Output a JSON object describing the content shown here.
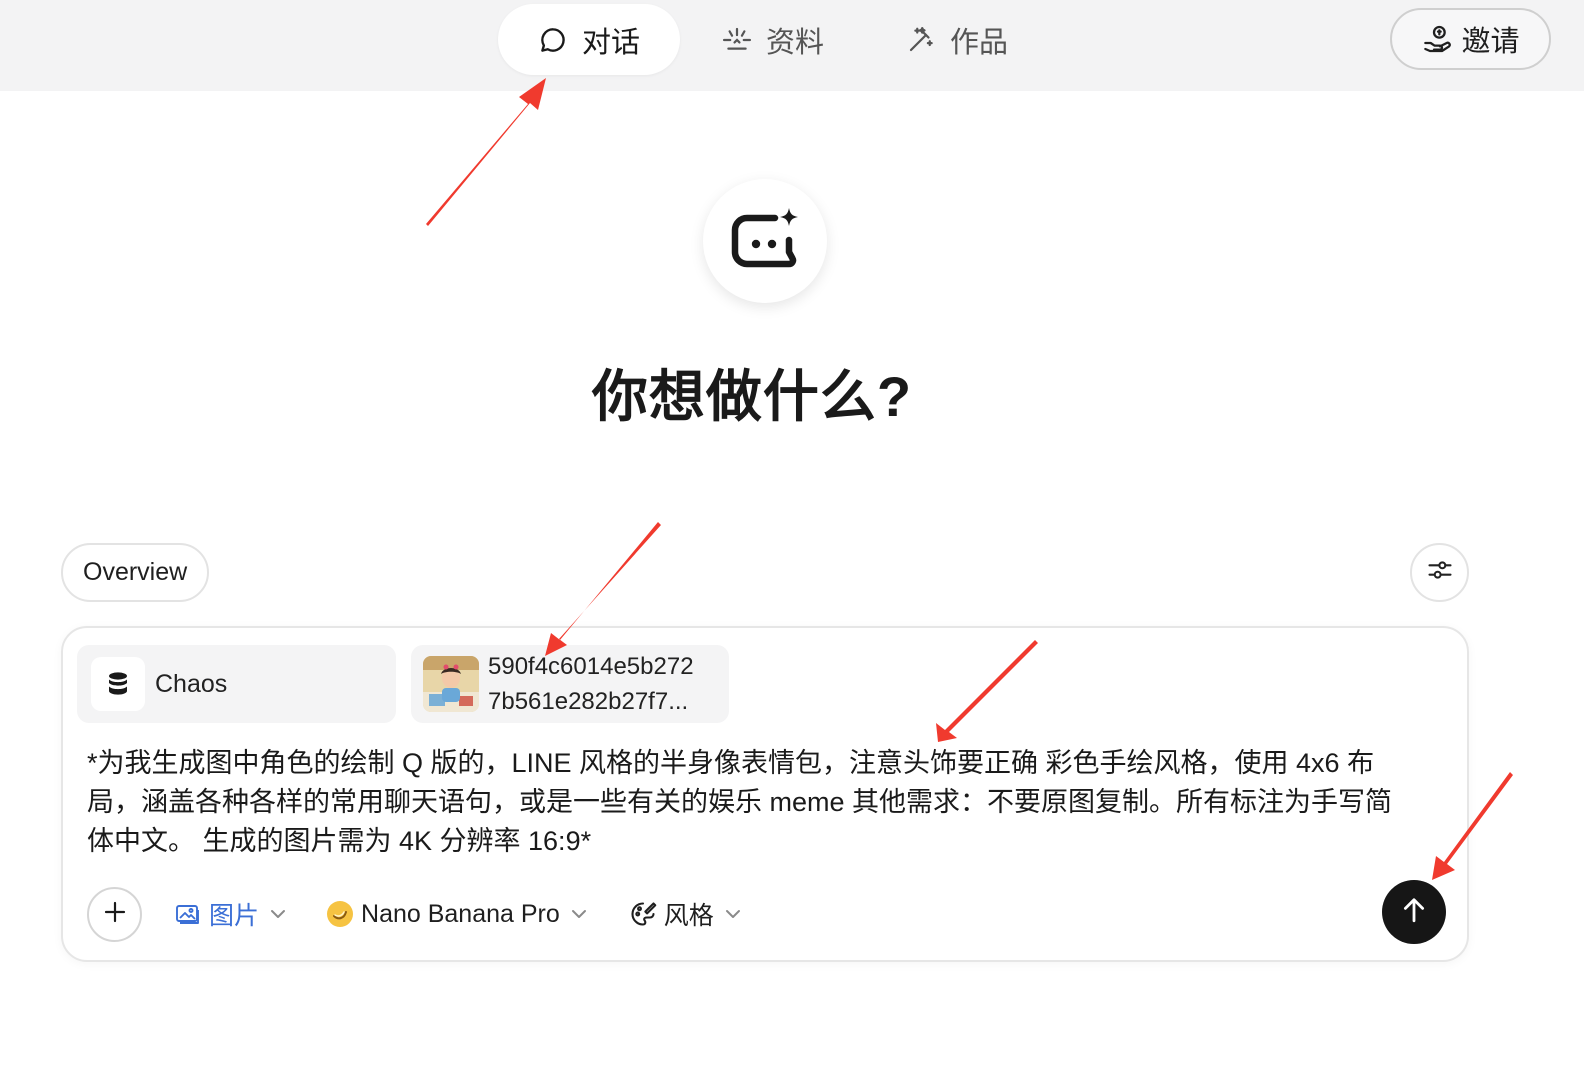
{
  "nav": {
    "tabs": [
      {
        "label": "对话",
        "icon": "chat-bubble-icon",
        "active": true
      },
      {
        "label": "资料",
        "icon": "sparkle-burst-icon",
        "active": false
      },
      {
        "label": "作品",
        "icon": "magic-wand-icon",
        "active": false
      }
    ],
    "invite_label": "邀请",
    "invite_icon": "hand-coin-icon"
  },
  "hero": {
    "logo_icon": "chat-bot-sparkle-icon",
    "headline": "你想做什么?"
  },
  "overview_label": "Overview",
  "settings_icon": "sliders-icon",
  "composer": {
    "attachments": [
      {
        "type": "knowledge",
        "label": "Chaos",
        "icon": "database-icon"
      },
      {
        "type": "image",
        "line1": "590f4c6014e5b272",
        "line2": "7b561e282b27f7..."
      }
    ],
    "prompt": "*为我生成图中角色的绘制 Q 版的，LINE 风格的半身像表情包，注意头饰要正确 彩色手绘风格，使用 4x6 布局，涵盖各种各样的常用聊天语句，或是一些有关的娱乐 meme 其他需求：不要原图复制。所有标注为手写简体中文。 生成的图片需为 4K 分辨率 16:9*",
    "toolbar": {
      "mode_label": "图片",
      "model_label": "Nano Banana Pro",
      "style_label": "风格"
    }
  },
  "colors": {
    "accent_blue": "#3b6fd6",
    "send_button": "#161616",
    "annotation_red": "#f03a2e",
    "nav_background": "#f3f3f4"
  }
}
